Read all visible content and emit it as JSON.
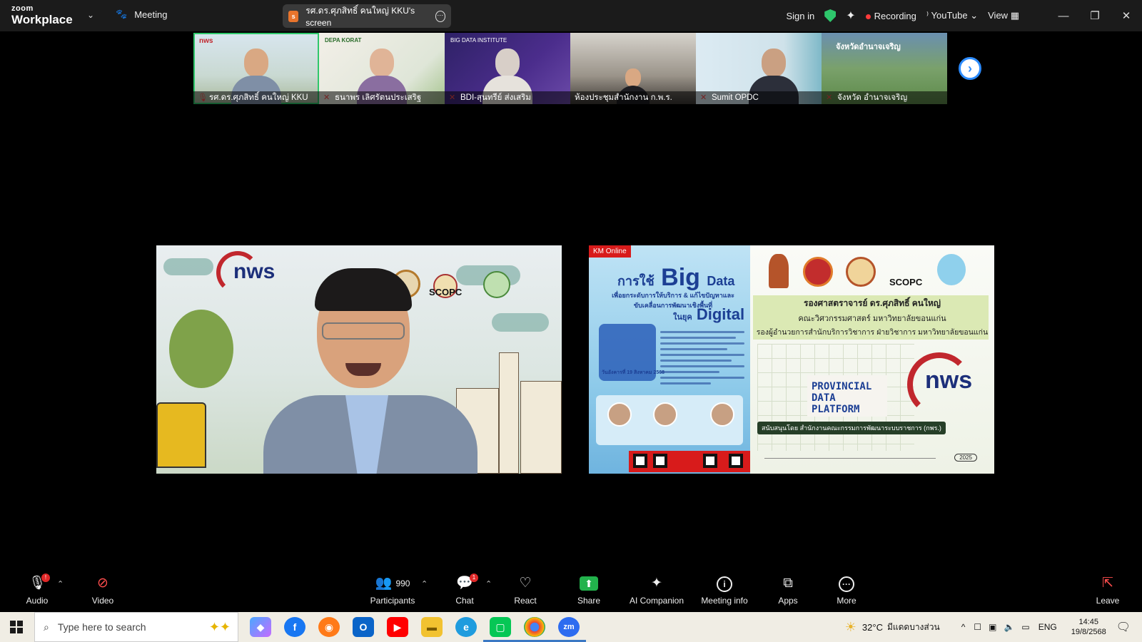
{
  "app": {
    "logo_top": "zoom",
    "logo_bottom": "Workplace",
    "meeting_label": "Meeting",
    "share_pill": {
      "avatar": "s",
      "label": "รศ.ดร.ศุภสิทธิ์ คนใหญ่ KKU's screen"
    },
    "sign_in": "Sign in",
    "recording": "Recording",
    "youtube": "YouTube",
    "view": "View"
  },
  "thumbnails": [
    {
      "name": "รศ.ดร.ศุภสิทธิ์ คนใหญ่ KKU",
      "active": true
    },
    {
      "name": "ธนาพร เลิศรัตนประเสริฐ"
    },
    {
      "name": "BDI-สุนทรีย์ ส่งเสริม"
    },
    {
      "name": "ห้องประชุมสำนักงาน ก.พ.ร."
    },
    {
      "name": "Sumit OPDC"
    },
    {
      "name": "จังหวัด อำนาจเจริญ"
    }
  ],
  "thumb_texts": {
    "t1_logo": "nws",
    "t2_logo": "DEPA KORAT",
    "t3_logo": "BIG DATA INSTITUTE",
    "t6_logo": "จังหวัดอำนาจเจริญ"
  },
  "left_tile": {
    "logo": "nws",
    "scopc": "SCOPC"
  },
  "poster": {
    "tag": "KM Online",
    "title_small": "การใช้",
    "title_big": "Big",
    "title_data": "Data",
    "subtitle": "เพื่อยกระดับการให้บริการ & แก้ไขปัญหาและขับเคลื่อนการพัฒนาเชิงพื้นที่",
    "title_era": "ในยุค",
    "title_digital": "Digital",
    "date": "วันอังคารที่ 19 สิงหาคม 2568"
  },
  "slide": {
    "scopc": "SCOPC",
    "name": "รองศาสตราจารย์ ดร.ศุภสิทธิ์ คนใหญ่",
    "line2": "คณะวิศวกรรมศาสตร์ มหาวิทยาลัยขอนแก่น",
    "line3": "รองผู้อำนวยการสำนักบริการวิชาการ ฝ่ายวิชาการ มหาวิทยาลัยขอนแก่น",
    "platform": "PROVINCIAL DATA PLATFORM",
    "support": "สนับสนุนโดย สำนักงานคณะกรรมการพัฒนาระบบราชการ (กพร.)",
    "year": "2025",
    "logo": "nws"
  },
  "toolbar": {
    "audio": "Audio",
    "audio_badge": "!",
    "video": "Video",
    "participants": "Participants",
    "participants_count": "990",
    "chat": "Chat",
    "chat_badge": "1",
    "react": "React",
    "share": "Share",
    "ai_companion": "AI Companion",
    "meeting_info": "Meeting info",
    "apps": "Apps",
    "more": "More",
    "leave": "Leave"
  },
  "taskbar": {
    "search_placeholder": "Type here to search",
    "weather_temp": "32°C",
    "weather_desc": "มีแดดบางส่วน",
    "lang": "ENG",
    "time": "14:45",
    "date": "19/8/2568",
    "zoom_app": "zm"
  },
  "colors": {
    "active_border": "#2fc76b",
    "share_green": "#22b24c",
    "zoom_blue": "#2d8cff",
    "rec_red": "#ff3b3b"
  }
}
